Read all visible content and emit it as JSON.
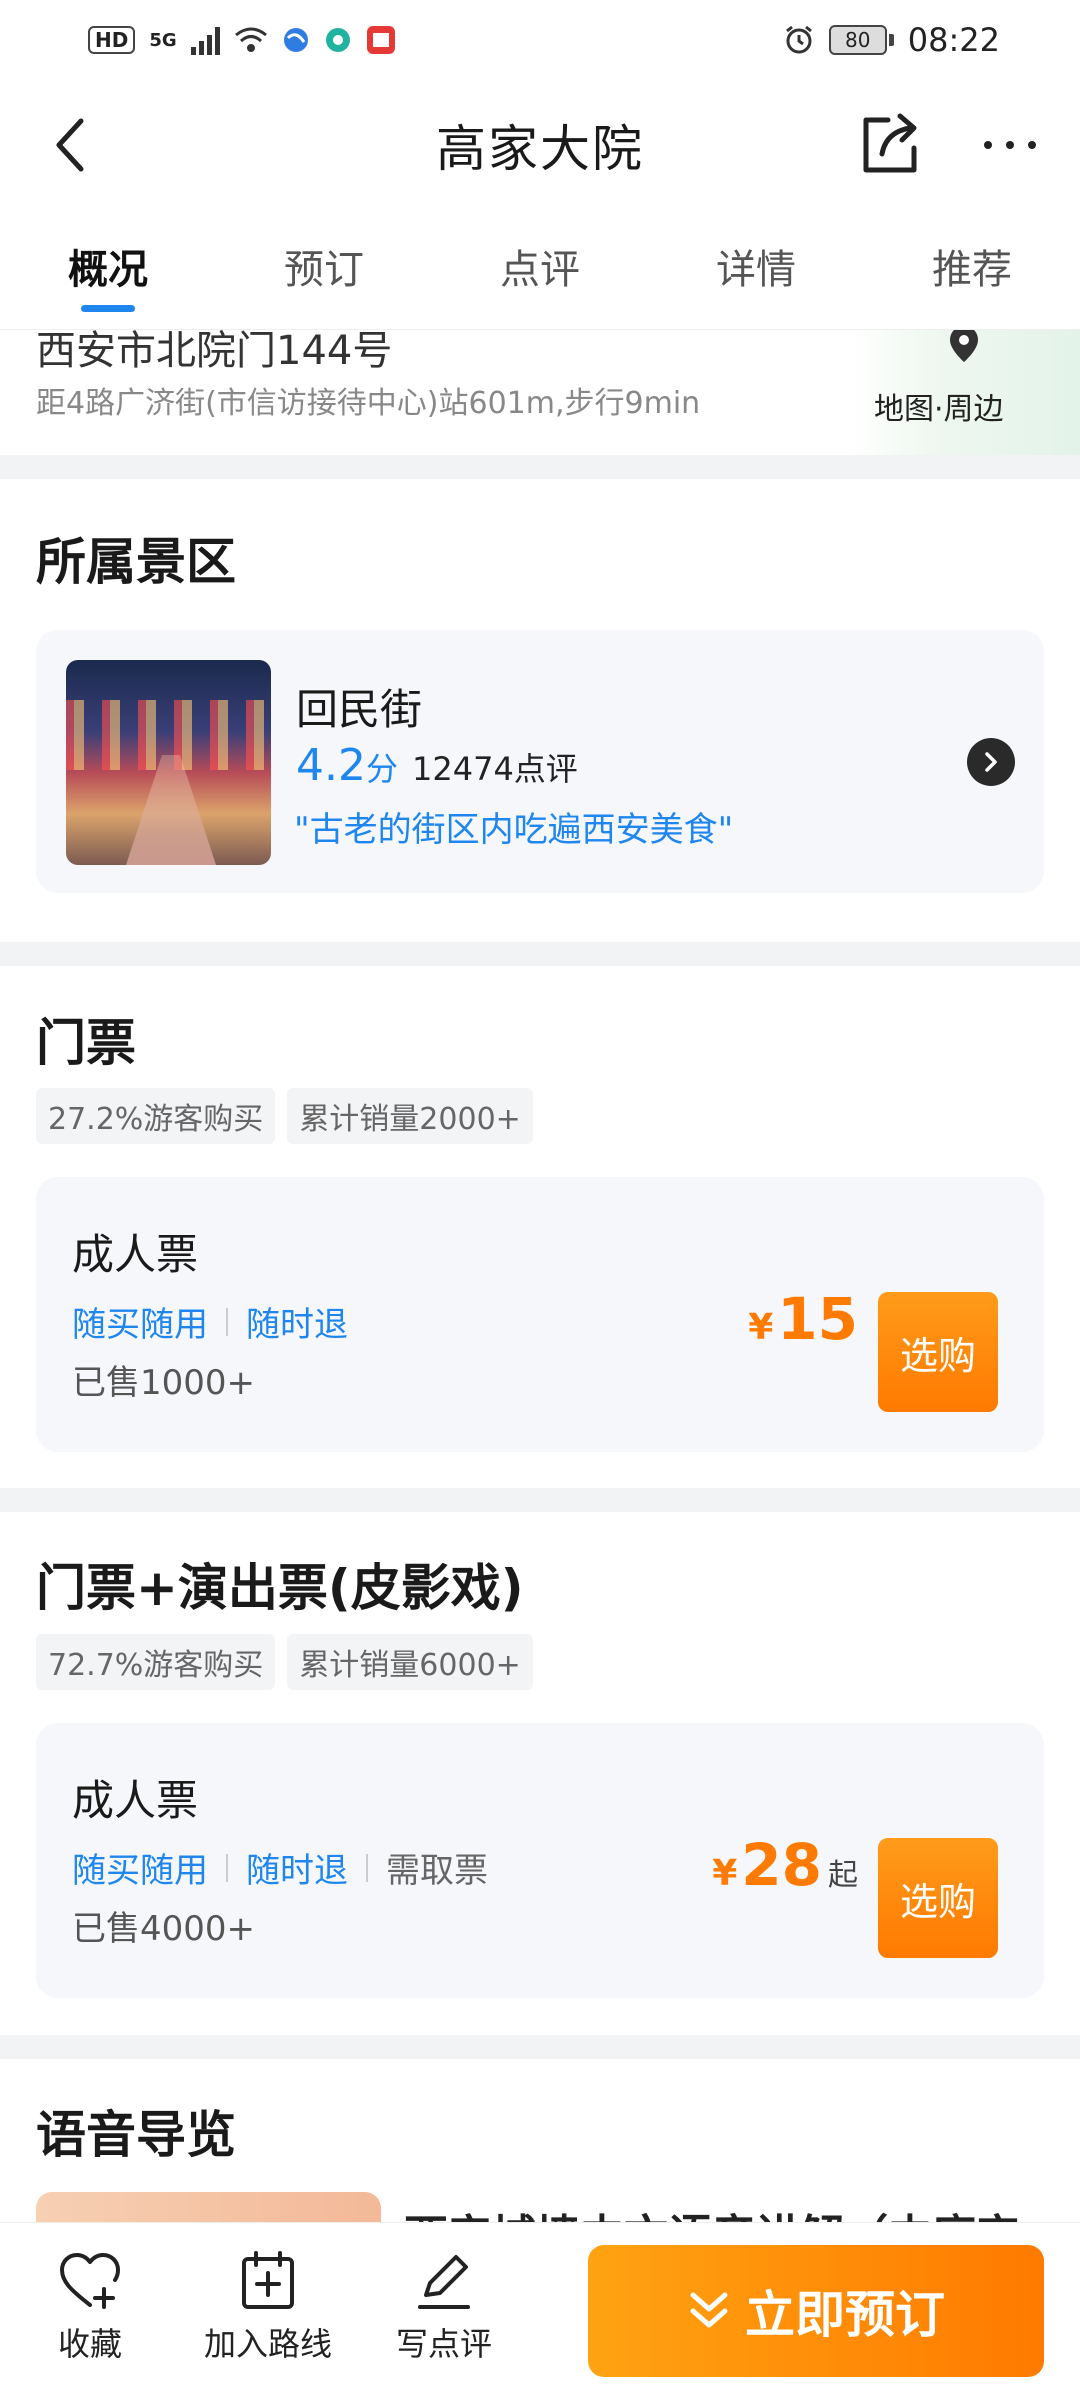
{
  "status_bar": {
    "hd": "HD",
    "net": "5G",
    "battery": "80",
    "time": "08:22"
  },
  "header": {
    "title": "高家大院"
  },
  "tabs": [
    "概况",
    "预订",
    "点评",
    "详情",
    "推荐"
  ],
  "address": {
    "line1": "西安市北院门144号",
    "line2": "距4路广济街(市信访接待中心)站601m,步行9min",
    "map_label": "地图·周边"
  },
  "scenic": {
    "section_title": "所属景区",
    "name": "回民街",
    "score": "4.2",
    "score_unit": "分",
    "reviews": "12474点评",
    "quote": "\"古老的街区内吃遍西安美食\""
  },
  "ticket1": {
    "section_title": "门票",
    "tags": [
      "27.2%游客购买",
      "累计销量2000+"
    ],
    "name": "成人票",
    "features": [
      "随买随用",
      "随时退"
    ],
    "sold": "已售1000+",
    "currency": "¥",
    "price": "15",
    "buy_label": "选购"
  },
  "ticket2": {
    "section_title": "门票+演出票(皮影戏)",
    "tags": [
      "72.7%游客购买",
      "累计销量6000+"
    ],
    "name": "成人票",
    "features": [
      "随买随用",
      "随时退",
      "需取票"
    ],
    "sold": "已售4000+",
    "currency": "¥",
    "price": "28",
    "price_suffix": "起",
    "buy_label": "选购"
  },
  "audio": {
    "section_title": "语音导览",
    "item_title": "西安城墙中文语音讲解（中庭定"
  },
  "bottom_bar": {
    "favorite": "收藏",
    "add_route": "加入路线",
    "write_review": "写点评",
    "book_now": "立即预订"
  }
}
